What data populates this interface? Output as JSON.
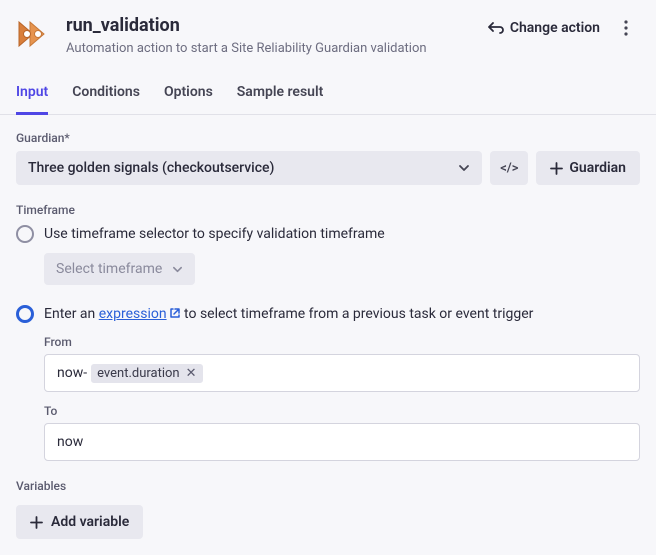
{
  "header": {
    "title": "run_validation",
    "description": "Automation action to start a Site Reliability Guardian validation",
    "change_action_label": "Change action"
  },
  "tabs": {
    "input": "Input",
    "conditions": "Conditions",
    "options": "Options",
    "sample_result": "Sample result"
  },
  "guardian": {
    "label": "Guardian*",
    "selected": "Three golden signals (checkoutservice)",
    "code_btn": "</>",
    "add_label": "Guardian"
  },
  "timeframe": {
    "label": "Timeframe",
    "option_selector": "Use timeframe selector to specify validation timeframe",
    "select_placeholder": "Select timeframe",
    "option_expression_pre": "Enter an ",
    "option_expression_link": "expression",
    "option_expression_post": " to select timeframe from a previous task or event trigger",
    "from_label": "From",
    "from_prefix": "now-",
    "from_chip": "event.duration",
    "to_label": "To",
    "to_value": "now"
  },
  "variables": {
    "label": "Variables",
    "add_label": "Add variable"
  }
}
